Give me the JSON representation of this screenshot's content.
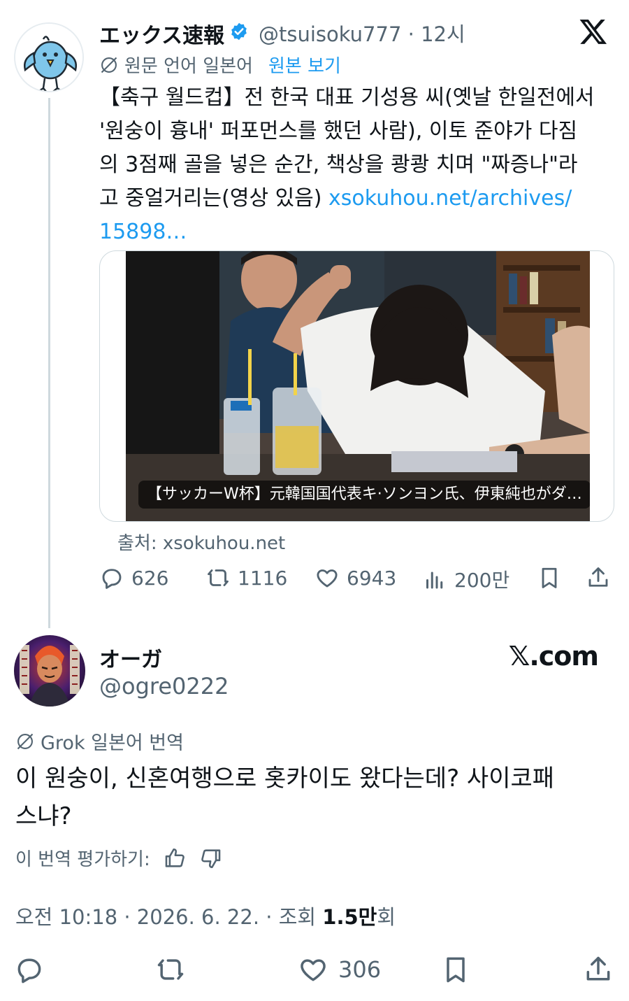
{
  "quoted": {
    "name": "エックス速報",
    "handle": "@tsuisoku777",
    "time": "12시",
    "translate_label": "원문 언어 일본어",
    "original_link": "원본 보기",
    "text_lines": [
      "【축구 월드컵】전 한국 대표 기성용 씨(옛날 한일전에서",
      "'원숭이 흉내' 퍼포먼스를 했던 사람), 이토 준야가 다짐",
      "의 3점째 골을 넣은 순간, 책상을 쾅쾅 치며 \"짜증나\"라",
      "고 중얼거리는(영상 있음) "
    ],
    "link_text": "xsokuhou.net/archives/",
    "link_text2": "15898…",
    "card_caption": "【サッカーW杯】元韓国国代表キ·ソンヨン氏、伊東純也がダ…",
    "source": "출처: xsokuhou.net",
    "counts": {
      "replies": "626",
      "retweets": "1116",
      "likes": "6943",
      "views": "200만"
    }
  },
  "main": {
    "name": "オーガ",
    "handle": "@ogre0222",
    "brand": "𝕏.com",
    "grok_label": "Grok 일본어 번역",
    "text_line1": "이 원숭이, 신혼여행으로 홋카이도 왔다는데? 사이코패",
    "text_line2": "스냐?",
    "rate_label": "이 번역 평가하기:",
    "meta_prefix": "오전 10:18 · 2026. 6. 22. · 조회 ",
    "meta_views": "1.5만",
    "meta_suffix": "회",
    "likes": "306"
  },
  "colors": {
    "accent": "#1d9bf0",
    "secondary_text": "#536471",
    "primary_text": "#0f1419",
    "border": "#cfd9de"
  },
  "icons": [
    "x-logo-icon",
    "verified-badge-icon",
    "globe-slash-icon",
    "reply-icon",
    "retweet-icon",
    "like-icon",
    "views-icon",
    "bookmark-icon",
    "share-icon",
    "thumbs-up-icon",
    "thumbs-down-icon"
  ]
}
